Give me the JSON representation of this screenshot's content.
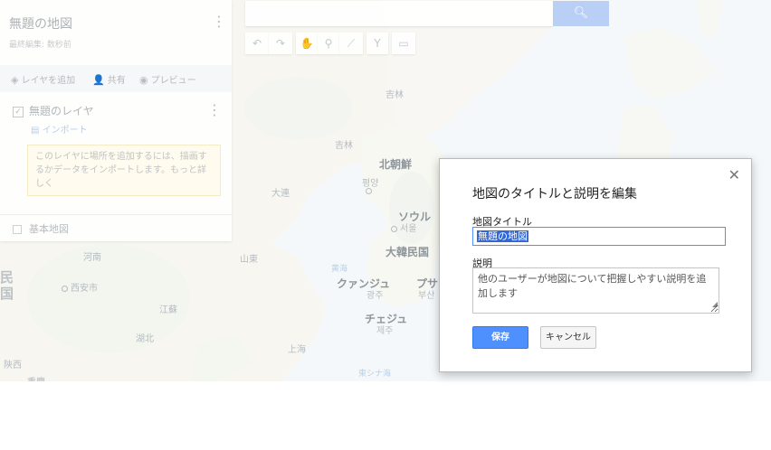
{
  "map": {
    "labels": {
      "harbin_area": "吉林",
      "jilin": "吉林",
      "north_korea": "北朝鮮",
      "pyongyang": "평양",
      "seoul": "ソウル",
      "seoul_kr": "서울",
      "south_korea": "大韓民国",
      "gwangju": "クァンジュ",
      "gwangju_kr": "광주",
      "jeju": "チェジュ",
      "jeju_kr": "제주",
      "busan": "プサ",
      "busan_kr": "부산",
      "shandong": "山東",
      "xian": "西安市",
      "shanghai": "上海",
      "east_china_sea": "東シナ海",
      "yellow_sea": "黄海",
      "china_partial": "民",
      "china_partial2": "国",
      "henan": "河南",
      "jiangsu": "江蘇",
      "hubei": "湖北",
      "shaanxi": "陝西",
      "chongqing": "重慶",
      "dalian": "大連"
    }
  },
  "panel": {
    "title": "無題の地図",
    "subtitle": "最終編集: 数秒前",
    "add_layer": "レイヤを追加",
    "share": "共有",
    "preview": "プレビュー",
    "layer_name": "無題のレイヤ",
    "import": "インポート",
    "tip": "このレイヤに場所を追加するには、描画するかデータをインポートします。もっと詳しく",
    "base_map": "基本地図"
  },
  "dialog": {
    "title": "地図のタイトルと説明を編集",
    "title_label": "地図タイトル",
    "title_value": "無題の地図",
    "desc_label": "説明",
    "desc_placeholder": "他のユーザーが地図について把握しやすい説明を追加します",
    "save": "保存",
    "cancel": "キャンセル"
  }
}
